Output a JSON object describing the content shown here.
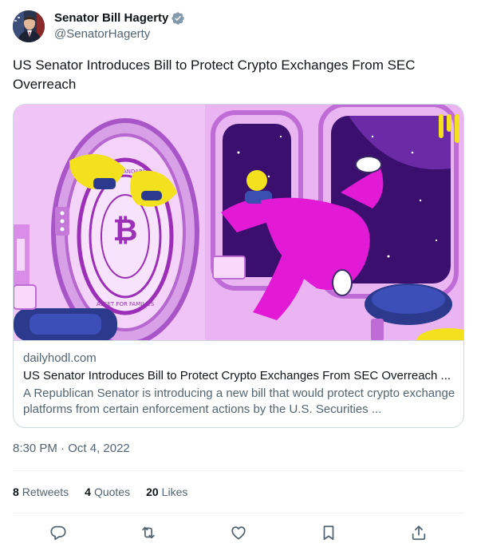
{
  "author": {
    "display_name": "Senator Bill Hagerty",
    "handle": "@SenatorHagerty",
    "avatar_icon": "person-avatar",
    "verified_icon": "verified-badge-icon"
  },
  "tweet": {
    "text": "US Senator Introduces Bill to Protect Crypto Exchanges From SEC Overreach",
    "time": "8:30 PM",
    "separator": "·",
    "date": "Oct 4, 2022"
  },
  "card": {
    "domain": "dailyhodl.com",
    "title": "US Senator Introduces Bill to Protect Crypto Exchanges From SEC Overreach ...",
    "description": "A Republican Senator is introducing a new bill that would protect crypto exchange platforms from certain enforcement actions by the U.S. Securities ...",
    "image_icon": "illustration-astronaut-crypto-vault",
    "coin_text_top": "THE STANDARD",
    "coin_text_bottom": "ASSET FOR FAMILIES"
  },
  "stats": [
    {
      "count": "8",
      "label": "Retweets"
    },
    {
      "count": "4",
      "label": "Quotes"
    },
    {
      "count": "20",
      "label": "Likes"
    }
  ],
  "actions": [
    {
      "name": "reply-icon"
    },
    {
      "name": "retweet-icon"
    },
    {
      "name": "like-icon"
    },
    {
      "name": "bookmark-icon"
    },
    {
      "name": "share-icon"
    }
  ],
  "colors": {
    "text_primary": "#0f1419",
    "text_secondary": "#536471",
    "border": "#cfd9de",
    "divider": "#eff3f4",
    "verified": "#829aab",
    "card_pink": "#e8aef0",
    "suit_magenta": "#e21ad6",
    "dog_yellow": "#f2e11c"
  }
}
